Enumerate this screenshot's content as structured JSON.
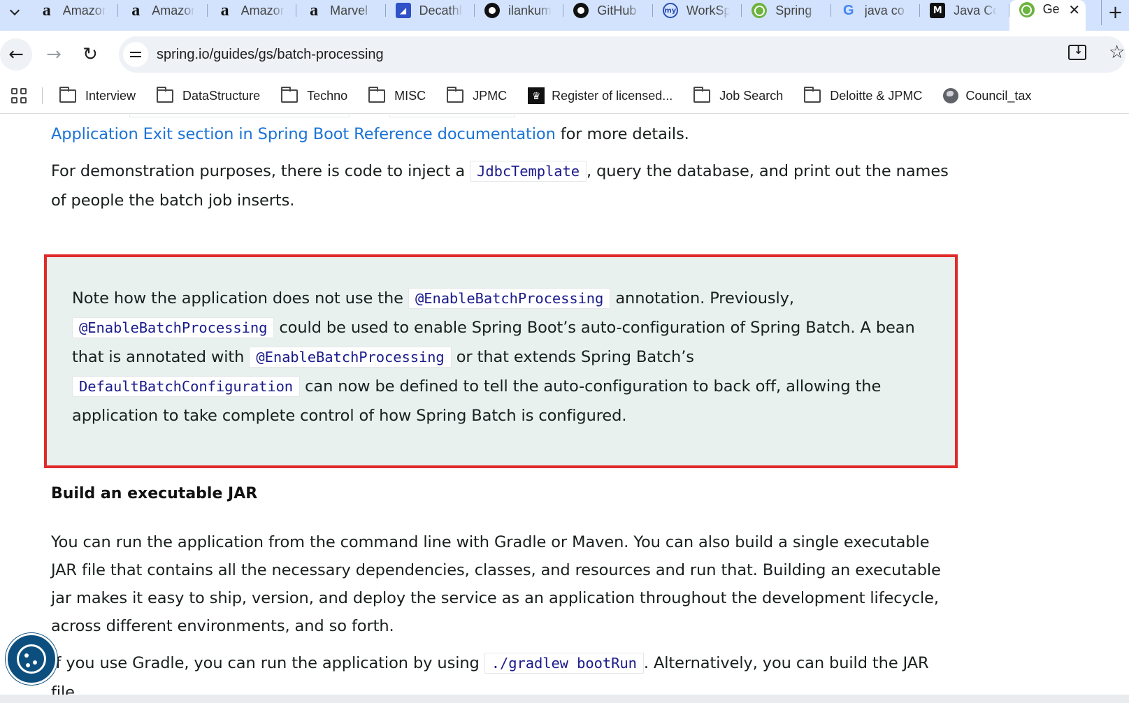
{
  "browser": {
    "tabs": [
      {
        "title": "Amazon",
        "icon": "amazon-icon"
      },
      {
        "title": "Amazon",
        "icon": "amazon-icon"
      },
      {
        "title": "Amazon",
        "icon": "amazon-icon"
      },
      {
        "title": "Marvel",
        "icon": "amazon-icon"
      },
      {
        "title": "Decathlon",
        "icon": "decathlon-icon"
      },
      {
        "title": "ilankumar",
        "icon": "github-icon"
      },
      {
        "title": "GitHub",
        "icon": "github-icon"
      },
      {
        "title": "WorkSpace",
        "icon": "workspace-icon"
      },
      {
        "title": "Spring",
        "icon": "spring-icon"
      },
      {
        "title": "java co",
        "icon": "google-icon"
      },
      {
        "title": "Java Co",
        "icon": "medium-icon"
      },
      {
        "title": "Ge",
        "icon": "spring-icon",
        "active": true
      }
    ],
    "url": "spring.io/guides/gs/batch-processing",
    "bookmarks": [
      {
        "label": "Interview",
        "icon": "folder-icon"
      },
      {
        "label": "DataStructure",
        "icon": "folder-icon"
      },
      {
        "label": "Techno",
        "icon": "folder-icon"
      },
      {
        "label": "MISC",
        "icon": "folder-icon"
      },
      {
        "label": "JPMC",
        "icon": "folder-icon"
      },
      {
        "label": "Register of licensed...",
        "icon": "crest-icon"
      },
      {
        "label": "Job Search",
        "icon": "folder-icon"
      },
      {
        "label": "Deloitte & JPMC",
        "icon": "folder-icon"
      },
      {
        "label": "Council_tax",
        "icon": "globe-icon"
      }
    ]
  },
  "content": {
    "p1_link": "Application Exit section in Spring Boot Reference documentation",
    "p1_tail": " for more details.",
    "p2_a": "For demonstration purposes, there is code to inject a ",
    "p2_code": "JdbcTemplate",
    "p2_b": ", query the database, and print out the names of people the batch job inserts.",
    "note": {
      "a": "Note how the application does not use the ",
      "code1": "@EnableBatchProcessing",
      "b": " annotation. Previously, ",
      "code2": "@EnableBatchProcessing",
      "c": " could be used to enable Spring Boot’s auto-configuration of Spring Batch. A bean that is annotated with ",
      "code3": "@EnableBatchProcessing",
      "d": " or that extends Spring Batch’s ",
      "code4": "DefaultBatchConfiguration",
      "e": " can now be defined to tell the auto-configuration to back off, allowing the application to take complete control of how Spring Batch is configured."
    },
    "heading": "Build an executable JAR",
    "p3": "You can run the application from the command line with Gradle or Maven. You can also build a single executable JAR file that contains all the necessary dependencies, classes, and resources and run that. Building an executable jar makes it easy to ship, version, and deploy the service as an application throughout the development lifecycle, across different environments, and so forth.",
    "p4_a": "If you use Gradle, you can run the application by using ",
    "p4_code": "./gradlew bootRun",
    "p4_b": ". Alternatively, you can build the JAR file"
  },
  "colors": {
    "tabstrip": "#d3e3fd",
    "link": "#1a73d6",
    "note_border": "#e02b2b",
    "note_bg": "#e9f1ef",
    "code_text": "#1a1a8c",
    "cookie_button": "#0c4f7e"
  }
}
